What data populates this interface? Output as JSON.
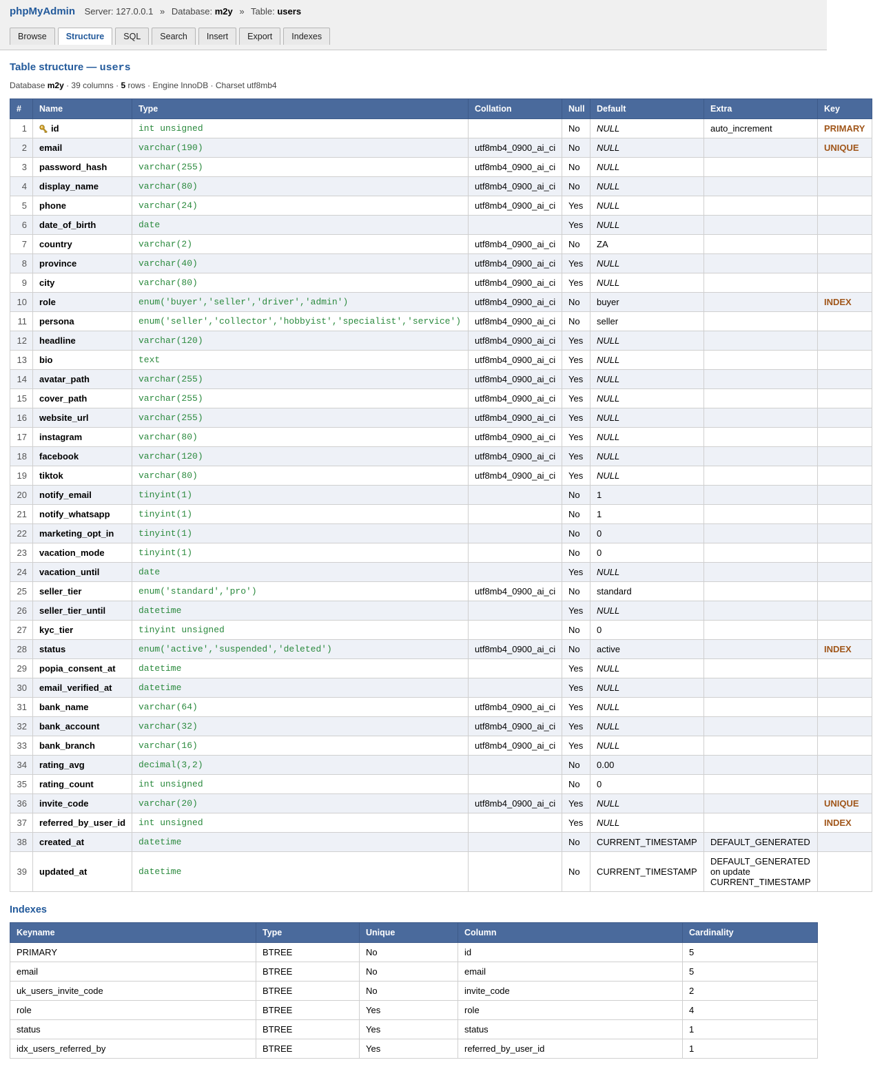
{
  "app": {
    "brand": "phpMyAdmin"
  },
  "breadcrumb": {
    "server_label": "Server:",
    "server": "127.0.0.1",
    "database_label": "Database:",
    "database": "m2y",
    "table_label": "Table:",
    "table": "users",
    "separator": "»"
  },
  "tabs": [
    "Browse",
    "Structure",
    "SQL",
    "Search",
    "Insert",
    "Export",
    "Indexes"
  ],
  "active_tab": "Structure",
  "heading": {
    "prefix": "Table structure — ",
    "table": "users"
  },
  "meta": {
    "db_label": "Database",
    "db": "m2y",
    "columns": "· 39 columns ·",
    "rows": "5",
    "rest": "rows · Engine InnoDB · Charset utf8mb4"
  },
  "structure": {
    "headers": [
      "#",
      "Name",
      "Type",
      "Collation",
      "Null",
      "Default",
      "Extra",
      "Key"
    ],
    "rows": [
      [
        "1",
        "id",
        "int unsigned",
        "",
        "No",
        "NULL",
        "auto_increment",
        "PRIMARY"
      ],
      [
        "2",
        "email",
        "varchar(190)",
        "utf8mb4_0900_ai_ci",
        "No",
        "NULL",
        "",
        "UNIQUE"
      ],
      [
        "3",
        "password_hash",
        "varchar(255)",
        "utf8mb4_0900_ai_ci",
        "No",
        "NULL",
        "",
        ""
      ],
      [
        "4",
        "display_name",
        "varchar(80)",
        "utf8mb4_0900_ai_ci",
        "No",
        "NULL",
        "",
        ""
      ],
      [
        "5",
        "phone",
        "varchar(24)",
        "utf8mb4_0900_ai_ci",
        "Yes",
        "NULL",
        "",
        ""
      ],
      [
        "6",
        "date_of_birth",
        "date",
        "",
        "Yes",
        "NULL",
        "",
        ""
      ],
      [
        "7",
        "country",
        "varchar(2)",
        "utf8mb4_0900_ai_ci",
        "No",
        "ZA",
        "",
        ""
      ],
      [
        "8",
        "province",
        "varchar(40)",
        "utf8mb4_0900_ai_ci",
        "Yes",
        "NULL",
        "",
        ""
      ],
      [
        "9",
        "city",
        "varchar(80)",
        "utf8mb4_0900_ai_ci",
        "Yes",
        "NULL",
        "",
        ""
      ],
      [
        "10",
        "role",
        "enum('buyer','seller','driver','admin')",
        "utf8mb4_0900_ai_ci",
        "No",
        "buyer",
        "",
        "INDEX"
      ],
      [
        "11",
        "persona",
        "enum('seller','collector','hobbyist','specialist','service')",
        "utf8mb4_0900_ai_ci",
        "No",
        "seller",
        "",
        ""
      ],
      [
        "12",
        "headline",
        "varchar(120)",
        "utf8mb4_0900_ai_ci",
        "Yes",
        "NULL",
        "",
        ""
      ],
      [
        "13",
        "bio",
        "text",
        "utf8mb4_0900_ai_ci",
        "Yes",
        "NULL",
        "",
        ""
      ],
      [
        "14",
        "avatar_path",
        "varchar(255)",
        "utf8mb4_0900_ai_ci",
        "Yes",
        "NULL",
        "",
        ""
      ],
      [
        "15",
        "cover_path",
        "varchar(255)",
        "utf8mb4_0900_ai_ci",
        "Yes",
        "NULL",
        "",
        ""
      ],
      [
        "16",
        "website_url",
        "varchar(255)",
        "utf8mb4_0900_ai_ci",
        "Yes",
        "NULL",
        "",
        ""
      ],
      [
        "17",
        "instagram",
        "varchar(80)",
        "utf8mb4_0900_ai_ci",
        "Yes",
        "NULL",
        "",
        ""
      ],
      [
        "18",
        "facebook",
        "varchar(120)",
        "utf8mb4_0900_ai_ci",
        "Yes",
        "NULL",
        "",
        ""
      ],
      [
        "19",
        "tiktok",
        "varchar(80)",
        "utf8mb4_0900_ai_ci",
        "Yes",
        "NULL",
        "",
        ""
      ],
      [
        "20",
        "notify_email",
        "tinyint(1)",
        "",
        "No",
        "1",
        "",
        ""
      ],
      [
        "21",
        "notify_whatsapp",
        "tinyint(1)",
        "",
        "No",
        "1",
        "",
        ""
      ],
      [
        "22",
        "marketing_opt_in",
        "tinyint(1)",
        "",
        "No",
        "0",
        "",
        ""
      ],
      [
        "23",
        "vacation_mode",
        "tinyint(1)",
        "",
        "No",
        "0",
        "",
        ""
      ],
      [
        "24",
        "vacation_until",
        "date",
        "",
        "Yes",
        "NULL",
        "",
        ""
      ],
      [
        "25",
        "seller_tier",
        "enum('standard','pro')",
        "utf8mb4_0900_ai_ci",
        "No",
        "standard",
        "",
        ""
      ],
      [
        "26",
        "seller_tier_until",
        "datetime",
        "",
        "Yes",
        "NULL",
        "",
        ""
      ],
      [
        "27",
        "kyc_tier",
        "tinyint unsigned",
        "",
        "No",
        "0",
        "",
        ""
      ],
      [
        "28",
        "status",
        "enum('active','suspended','deleted')",
        "utf8mb4_0900_ai_ci",
        "No",
        "active",
        "",
        "INDEX"
      ],
      [
        "29",
        "popia_consent_at",
        "datetime",
        "",
        "Yes",
        "NULL",
        "",
        ""
      ],
      [
        "30",
        "email_verified_at",
        "datetime",
        "",
        "Yes",
        "NULL",
        "",
        ""
      ],
      [
        "31",
        "bank_name",
        "varchar(64)",
        "utf8mb4_0900_ai_ci",
        "Yes",
        "NULL",
        "",
        ""
      ],
      [
        "32",
        "bank_account",
        "varchar(32)",
        "utf8mb4_0900_ai_ci",
        "Yes",
        "NULL",
        "",
        ""
      ],
      [
        "33",
        "bank_branch",
        "varchar(16)",
        "utf8mb4_0900_ai_ci",
        "Yes",
        "NULL",
        "",
        ""
      ],
      [
        "34",
        "rating_avg",
        "decimal(3,2)",
        "",
        "No",
        "0.00",
        "",
        ""
      ],
      [
        "35",
        "rating_count",
        "int unsigned",
        "",
        "No",
        "0",
        "",
        ""
      ],
      [
        "36",
        "invite_code",
        "varchar(20)",
        "utf8mb4_0900_ai_ci",
        "Yes",
        "NULL",
        "",
        "UNIQUE"
      ],
      [
        "37",
        "referred_by_user_id",
        "int unsigned",
        "",
        "Yes",
        "NULL",
        "",
        "INDEX"
      ],
      [
        "38",
        "created_at",
        "datetime",
        "",
        "No",
        "CURRENT_TIMESTAMP",
        "DEFAULT_GENERATED",
        ""
      ],
      [
        "39",
        "updated_at",
        "datetime",
        "",
        "No",
        "CURRENT_TIMESTAMP",
        "DEFAULT_GENERATED on update CURRENT_TIMESTAMP",
        ""
      ]
    ]
  },
  "indexes": {
    "title": "Indexes",
    "headers": [
      "Keyname",
      "Type",
      "Unique",
      "Column",
      "Cardinality"
    ],
    "rows": [
      [
        "PRIMARY",
        "BTREE",
        "No",
        "id",
        "5"
      ],
      [
        "email",
        "BTREE",
        "No",
        "email",
        "5"
      ],
      [
        "uk_users_invite_code",
        "BTREE",
        "No",
        "invite_code",
        "2"
      ],
      [
        "role",
        "BTREE",
        "Yes",
        "role",
        "4"
      ],
      [
        "status",
        "BTREE",
        "Yes",
        "status",
        "1"
      ],
      [
        "idx_users_referred_by",
        "BTREE",
        "Yes",
        "referred_by_user_id",
        "1"
      ]
    ]
  },
  "icons": {
    "primary_key": "key-icon"
  },
  "colors": {
    "accent": "#235a9b",
    "header_bg": "#4a6a9c",
    "type_text": "#2b8a3e",
    "key_text": "#a0561a",
    "alt_row": "#eef1f7"
  }
}
